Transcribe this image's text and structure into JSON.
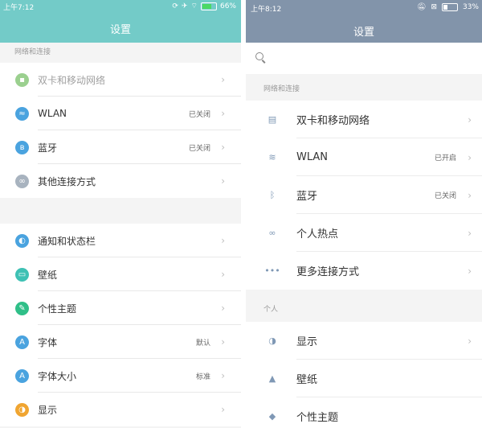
{
  "left": {
    "status": {
      "time": "上午7:12",
      "battery": "66%",
      "battery_level": 0.66
    },
    "title": "设置",
    "section_network": "网络和连接",
    "network_items": [
      {
        "label": "双卡和移动网络",
        "value": "",
        "icon": "sim-icon",
        "color": "#9bd08f",
        "disabled": true
      },
      {
        "label": "WLAN",
        "value": "已关闭",
        "icon": "wifi-icon",
        "color": "#4aa3df"
      },
      {
        "label": "蓝牙",
        "value": "已关闭",
        "icon": "bluetooth-icon",
        "color": "#4aa3df"
      },
      {
        "label": "其他连接方式",
        "value": "",
        "icon": "link-icon",
        "color": "#a8b3bf"
      }
    ],
    "personal_items": [
      {
        "label": "通知和状态栏",
        "value": "",
        "icon": "toggle-icon",
        "color": "#4aa3df"
      },
      {
        "label": "壁纸",
        "value": "",
        "icon": "wallpaper-icon",
        "color": "#3ec1b4"
      },
      {
        "label": "个性主题",
        "value": "",
        "icon": "theme-icon",
        "color": "#2fbf88"
      },
      {
        "label": "字体",
        "value": "默认",
        "icon": "font-icon",
        "glyph": "A",
        "color": "#4aa3df"
      },
      {
        "label": "字体大小",
        "value": "标准",
        "icon": "font-size-icon",
        "glyph": "A",
        "color": "#4aa3df"
      },
      {
        "label": "显示",
        "value": "",
        "icon": "display-icon",
        "color": "#f0a531"
      }
    ]
  },
  "right": {
    "status": {
      "time": "上午8:12",
      "battery": "33%",
      "battery_level": 0.33
    },
    "title": "设置",
    "section_network": "网络和连接",
    "network_items": [
      {
        "label": "双卡和移动网络",
        "value": "",
        "icon": "sim-icon"
      },
      {
        "label": "WLAN",
        "value": "已开启",
        "icon": "wifi-icon"
      },
      {
        "label": "蓝牙",
        "value": "已关闭",
        "icon": "bluetooth-icon"
      },
      {
        "label": "个人热点",
        "value": "",
        "icon": "hotspot-icon"
      },
      {
        "label": "更多连接方式",
        "value": "",
        "icon": "more-icon"
      }
    ],
    "section_personal": "个人",
    "personal_items": [
      {
        "label": "显示",
        "value": "",
        "icon": "display-icon"
      },
      {
        "label": "壁纸",
        "value": "",
        "icon": "wallpaper-icon"
      },
      {
        "label": "个性主题",
        "value": "",
        "icon": "theme-icon"
      }
    ]
  }
}
